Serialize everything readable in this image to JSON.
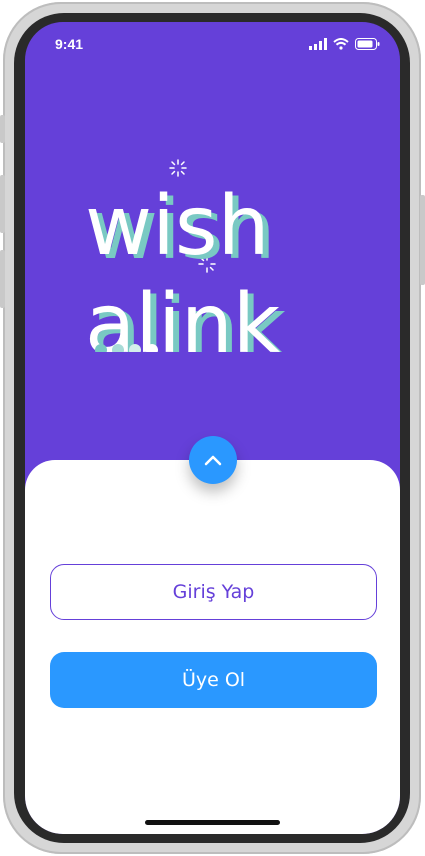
{
  "status_bar": {
    "time": "9:41"
  },
  "logo": {
    "line1": "wish",
    "line2": "alink"
  },
  "actions": {
    "expand_icon": "chevron-up-icon",
    "login_label": "Giriş Yap",
    "register_label": "Üye Ol"
  },
  "colors": {
    "header_bg": "#6540d9",
    "accent_blue": "#2a98ff",
    "logo_teal": "#79c9c3",
    "sheet_bg": "#ffffff"
  }
}
